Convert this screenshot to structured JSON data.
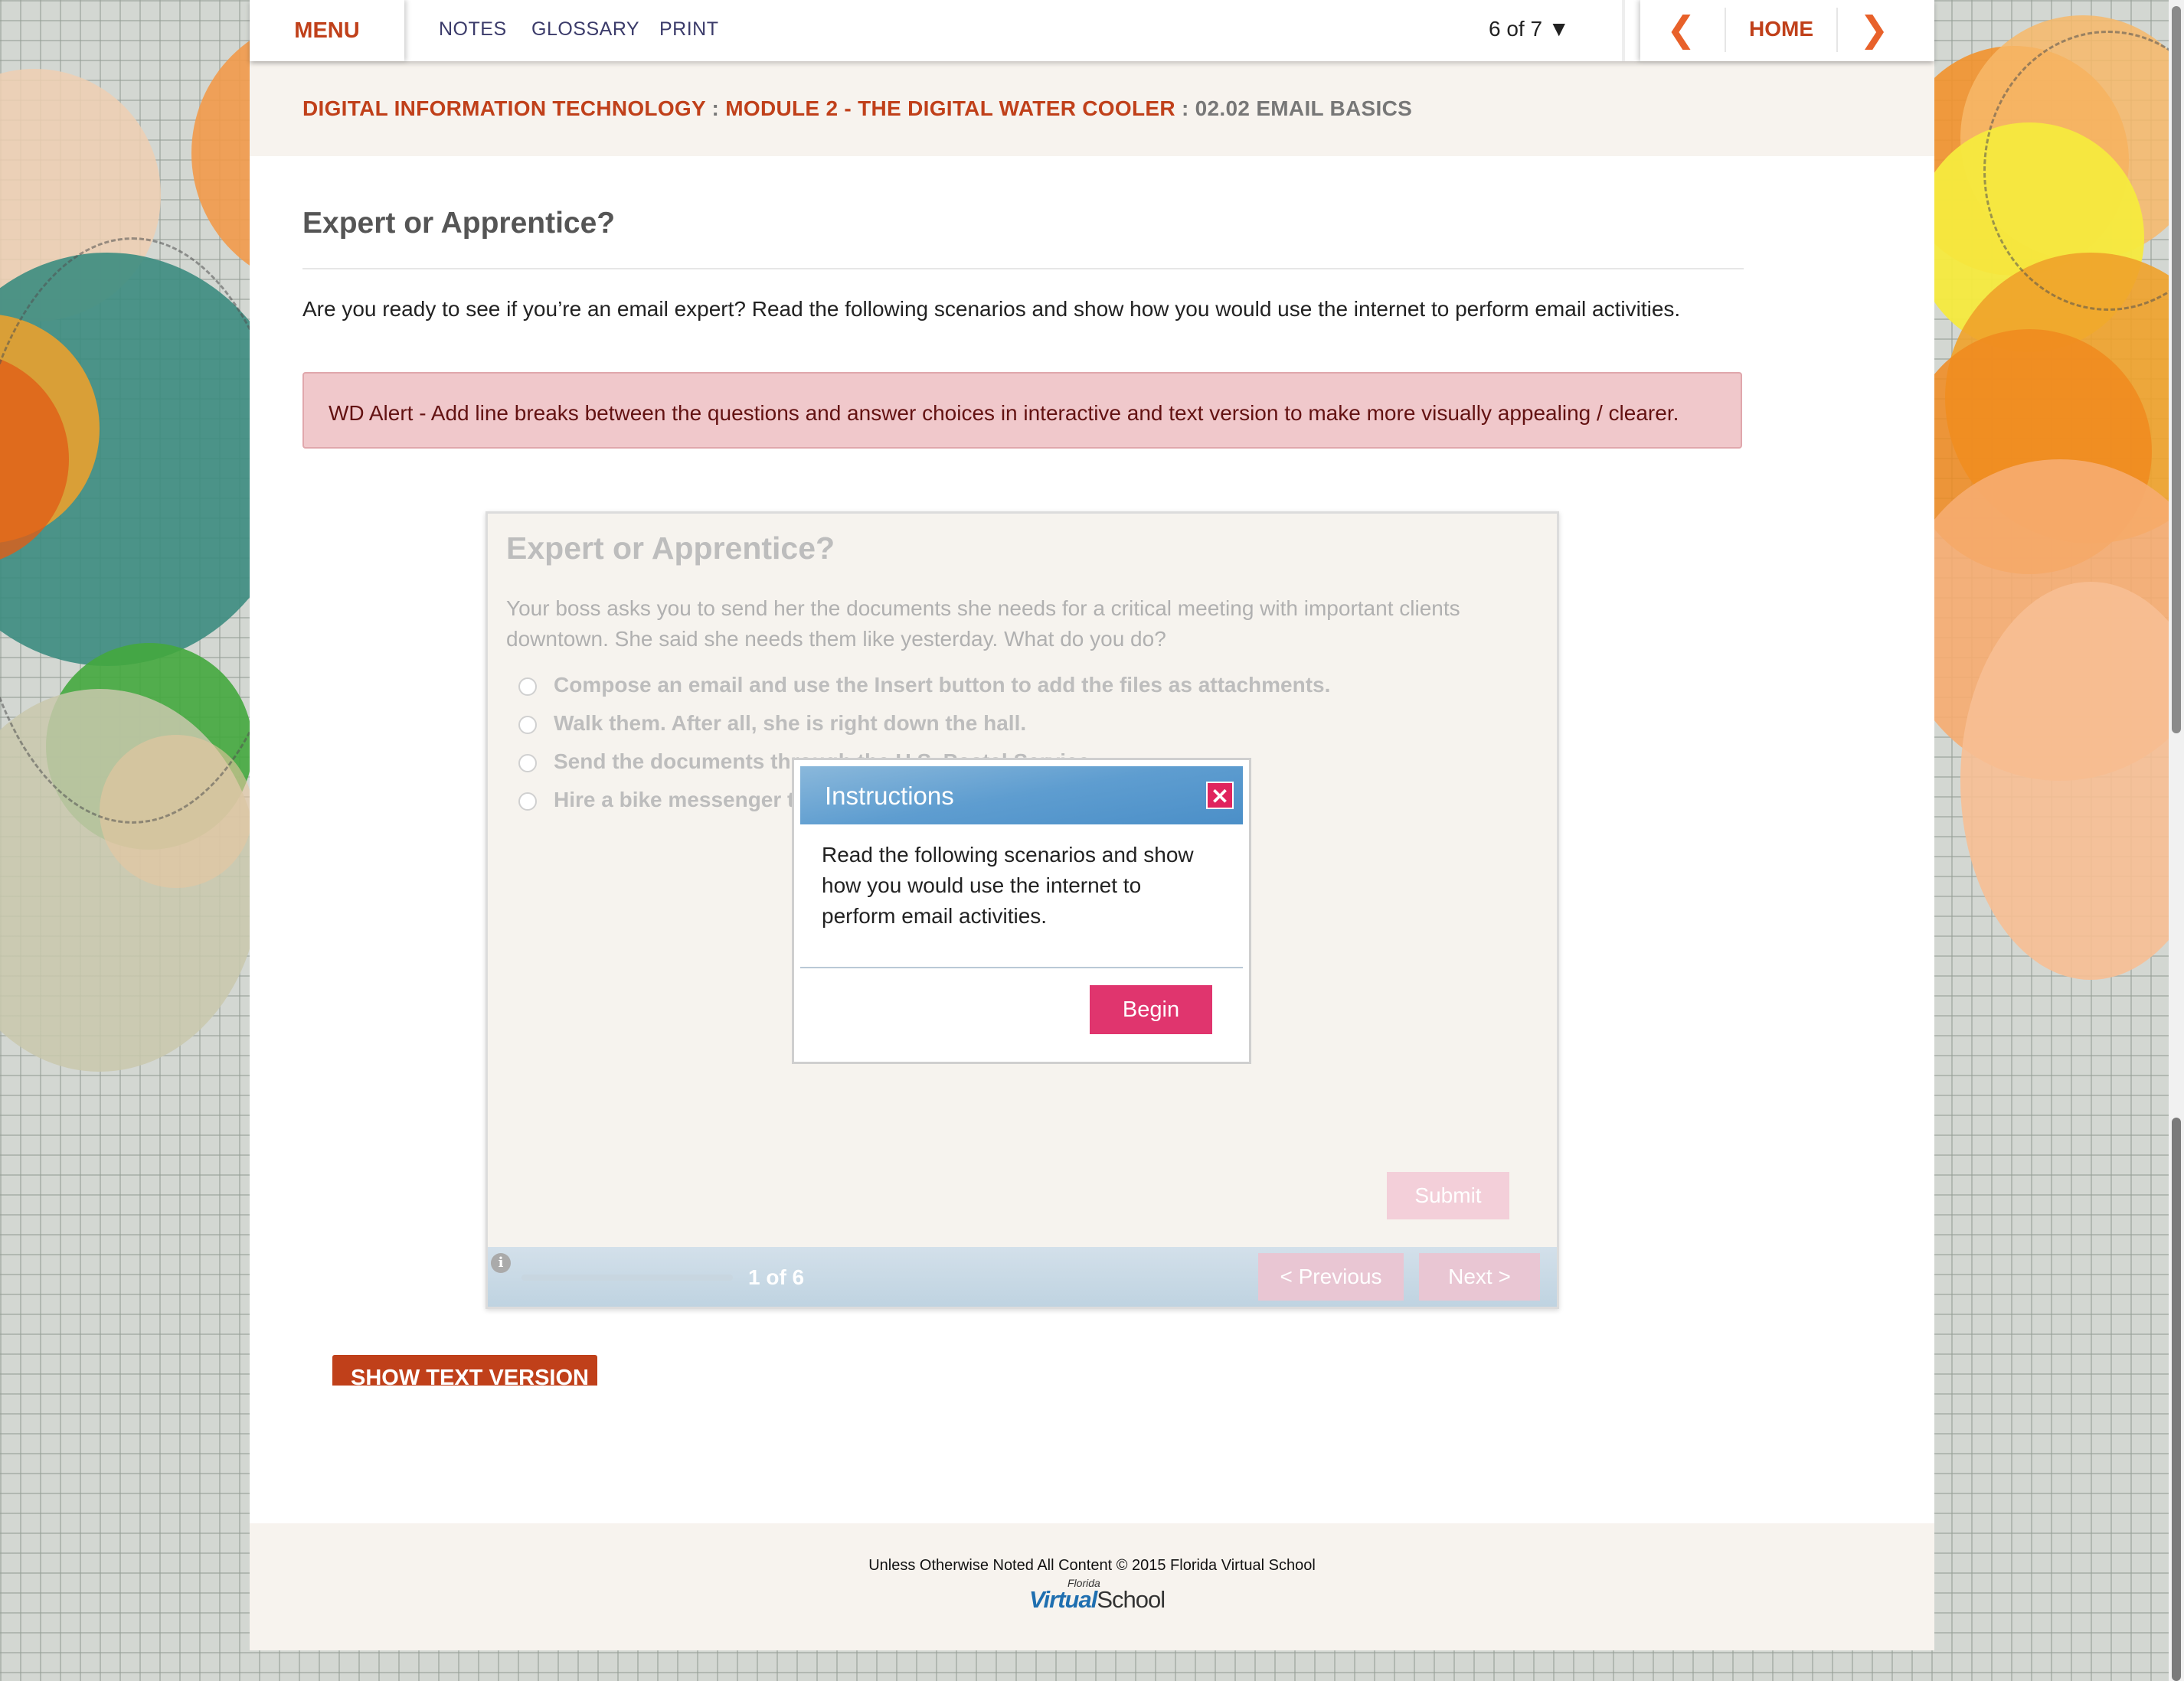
{
  "topbar": {
    "menu_label": "MENU",
    "links": [
      "NOTES",
      "GLOSSARY",
      "PRINT"
    ],
    "page_counter": "6 of 7 ▼",
    "prev_icon": "chevron-left-icon",
    "home_label": "HOME",
    "next_icon": "chevron-right-icon"
  },
  "breadcrumb": {
    "course": "DIGITAL INFORMATION TECHNOLOGY",
    "sep1": " : ",
    "module": "MODULE 2 - THE DIGITAL WATER COOLER",
    "sep2": " : ",
    "lesson": "02.02 EMAIL BASICS"
  },
  "content": {
    "title": "Expert or Apprentice?",
    "intro": "Are you ready to see if you’re an email expert? Read the following scenarios and show how you would use the internet to perform email activities.",
    "alert": "WD Alert - Add line breaks between the questions and answer choices in interactive and text version to make more visually appealing / clearer."
  },
  "quiz": {
    "title": "Expert or Apprentice?",
    "scenario": "Your boss asks you to send her the documents she needs for a critical meeting with important clients downtown. She said she needs them like yesterday. What do you do?",
    "choices": [
      "Compose an email and use the Insert button to add the files as attachments.",
      "Walk them. After all, she is right down the hall.",
      "Send the documents through the U.S. Postal Service.",
      "Hire a bike messenger to deliver the documents."
    ],
    "submit_label": "Submit",
    "progress": "1 of 6",
    "progress_fraction": 0.0,
    "info_icon": "info-icon",
    "prev_label": "< Previous",
    "next_label": "Next >"
  },
  "modal": {
    "title": "Instructions",
    "close_icon": "close-icon",
    "body": "Read the following scenarios and show how you would use the internet to perform email activities.",
    "begin_label": "Begin"
  },
  "show_text_label": "SHOW TEXT VERSION",
  "footer": {
    "copyright": "Unless Otherwise Noted All Content © 2015 Florida Virtual School",
    "logo_small": "Florida",
    "logo_virtual": "Virtual",
    "logo_school": "School"
  },
  "colors": {
    "accent": "#c0401a",
    "arrow": "#e8612a",
    "modal_header": "#5e9dd0",
    "begin_button": "#e0356e",
    "alert_bg": "#f0c8cb"
  }
}
